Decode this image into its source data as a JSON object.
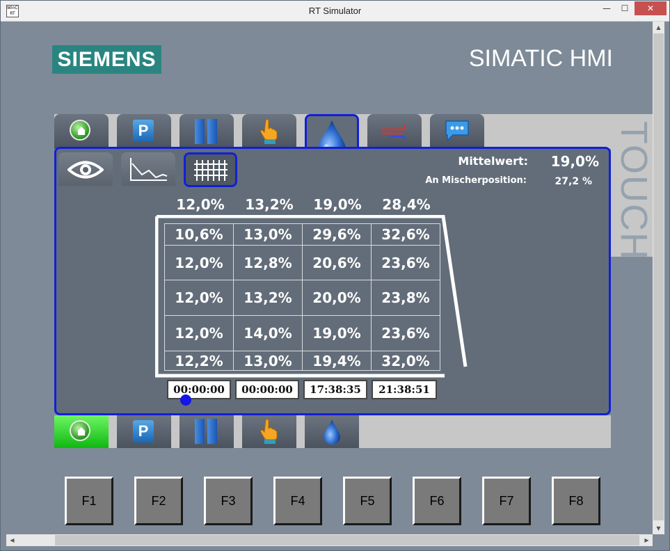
{
  "window": {
    "title": "RT Simulator",
    "app_icon_text": "WinCC RT",
    "minimize_label": "—",
    "maximize_label": "☐",
    "close_label": "✕"
  },
  "header": {
    "brand": "SIEMENS",
    "product": "SIMATIC HMI",
    "side_label": "TOUCH"
  },
  "top_nav": [
    {
      "icon": "home-icon"
    },
    {
      "icon": "parking-icon",
      "label": "P"
    },
    {
      "icon": "pause-icon"
    },
    {
      "icon": "hand-icon"
    },
    {
      "icon": "water-drop-icon",
      "selected": true
    },
    {
      "icon": "airflow-icon"
    },
    {
      "icon": "chat-icon"
    }
  ],
  "sub_nav": [
    {
      "icon": "eye-icon"
    },
    {
      "icon": "trend-icon"
    },
    {
      "icon": "grid-icon",
      "selected": true
    }
  ],
  "stats": {
    "mean_label": "Mittelwert:",
    "mean_value": "19,0%",
    "mixer_label": "An Mischerposition:",
    "mixer_value": "27,2 %"
  },
  "column_averages": [
    "12,0%",
    "13,2%",
    "19,0%",
    "28,4%"
  ],
  "grid_rows": [
    [
      "10,6%",
      "13,0%",
      "29,6%",
      "32,6%"
    ],
    [
      "12,0%",
      "12,8%",
      "20,6%",
      "23,6%"
    ],
    [
      "12,0%",
      "13,2%",
      "20,0%",
      "23,8%"
    ],
    [
      "12,0%",
      "14,0%",
      "19,0%",
      "23,6%"
    ],
    [
      "12,2%",
      "13,0%",
      "19,4%",
      "32,0%"
    ]
  ],
  "times": [
    "00:00:00",
    "00:00:00",
    "17:38:35",
    "21:38:51"
  ],
  "bottom_nav": [
    {
      "icon": "home-icon",
      "active": true
    },
    {
      "icon": "parking-icon",
      "label": "P"
    },
    {
      "icon": "pause-icon"
    },
    {
      "icon": "hand-icon"
    },
    {
      "icon": "water-drop-icon"
    }
  ],
  "function_keys": [
    "F1",
    "F2",
    "F3",
    "F4",
    "F5",
    "F6",
    "F7",
    "F8"
  ],
  "colors": {
    "accent_blue": "#1020d8",
    "panel": "#636d79",
    "background": "#7e8a97",
    "brand_teal": "#2a8580",
    "active_green": "#3ad83a"
  }
}
